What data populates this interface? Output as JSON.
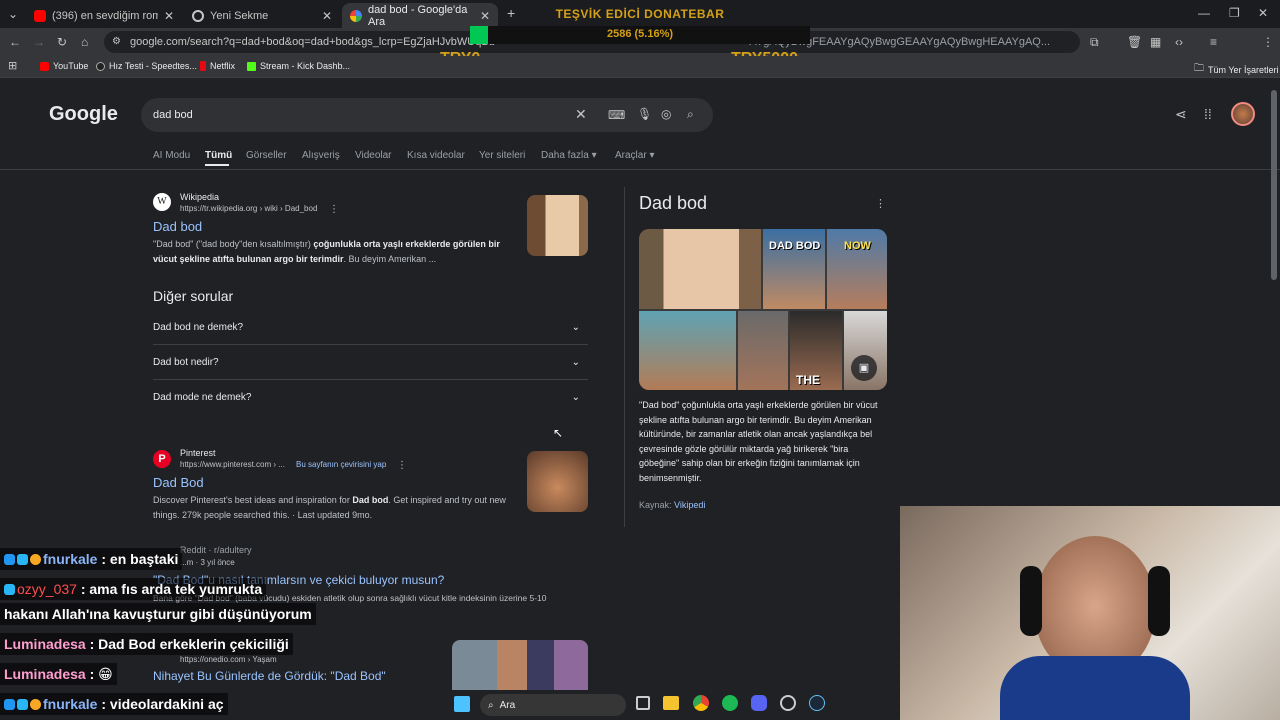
{
  "tabs": [
    {
      "title": "(396) en sevdiğim roman kavga",
      "close": "✕"
    },
    {
      "title": "Yeni Sekme",
      "close": "✕"
    },
    {
      "title": "dad bod - Google'da Ara",
      "close": "✕"
    }
  ],
  "new_tab": "+",
  "address": "google.com/search?q=dad+bod&oq=dad+bod&gs_lcrp=EgZjaHJvbWUqBu",
  "address_tail": "AYgAQyBwgFEAAYgAQyBwgGEAAYgAQyBwgHEAAYgAQ...",
  "bookmarks": [
    "YouTube",
    "Hız Testi - Speedtes...",
    "Netflix",
    "Stream - Kick Dashb..."
  ],
  "all_bookmarks": "Tüm Yer İşaretleri",
  "donation": {
    "title": "TEŞVİK EDİCİ DONATEBAR",
    "amount": "2586 (5.16%)",
    "min": "TRY0",
    "max": "TRY5000",
    "color": "#d4a017"
  },
  "google": {
    "logo": "Google",
    "query": "dad bod",
    "nav": [
      "AI Modu",
      "Tümü",
      "Görseller",
      "Alışveriş",
      "Videolar",
      "Kısa videolar",
      "Yer siteleri",
      "Daha fazla ▾",
      "Araçlar ▾"
    ],
    "result1": {
      "site": "Wikipedia",
      "url": "https://tr.wikipedia.org › wiki › Dad_bod",
      "title": "Dad bod",
      "snip_a": "\"Dad bod\" (\"dad body\"den kısaltılmıştır) ",
      "snip_b": "çoğunlukla orta yaşlı erkeklerde görülen bir vücut şekline atıfta bulunan argo bir terimdir",
      "snip_c": ". Bu deyim Amerikan ..."
    },
    "other_q_title": "Diğer sorular",
    "questions": [
      "Dad bod ne demek?",
      "Dad bot nedir?",
      "Dad mode ne demek?"
    ],
    "result2": {
      "site": "Pinterest",
      "url": "https://www.pinterest.com › ...",
      "translate": "Bu sayfanın çevirisini yap",
      "title": "Dad Bod",
      "snip_a": "Discover Pinterest's best ideas and inspiration for ",
      "snip_b": "Dad bod",
      "snip_c": ". Get inspired and try out new things. 279k people searched this. · Last updated 9mo."
    },
    "result3": {
      "site": "Reddit · r/adultery",
      "meta": "...m · 3 yıl önce",
      "title": "\"Dad Bod\"u nasıl tanımlarsın ve çekici buluyor musun?",
      "snip": "Bana göre \"Dad bod\" (baba vücudu) eskiden atletik olup sonra sağlıklı vücut kitle indeksinin üzerine 5-10"
    },
    "result4": {
      "url": "https://onedio.com › Yaşam",
      "title": "Nihayet Bu Günlerde de Gördük: \"Dad Bod\""
    },
    "kp": {
      "title": "Dad bod",
      "image_label_1": "DAD BOD",
      "image_label_2": "NOW",
      "image_label_3": "THE",
      "desc": "\"Dad bod\" çoğunlukla orta yaşlı erkeklerde görülen bir vücut şekline atıfta bulunan argo bir terimdir. Bu deyim Amerikan kültüründe, bir zamanlar atletik olan ancak yaşlandıkça bel çevresinde gözle görülür miktarda yağ birikerek \"bira göbeğine\" sahip olan bir erkeğin fiziğini tanımlamak için benimsenmiştir.",
      "src_label": "Kaynak: ",
      "src": "Vikipedi"
    }
  },
  "chat": [
    {
      "user": "fnurkale",
      "msg": ": en baştaki",
      "color": "#8ab4f8"
    },
    {
      "user": "ozyy_037",
      "msg": ": ama fıs arda tek yumrukta",
      "color": "#ff4d4d"
    },
    {
      "user": "",
      "msg": "hakanı Allah'ına kavuşturur gibi düşünüyorum",
      "color": "#ffffff"
    },
    {
      "user": "Luminadesa",
      "msg": ": Dad Bod erkeklerin çekiciliği",
      "color": "#ff9ecf"
    },
    {
      "user": "Luminadesa",
      "msg": ": 😁",
      "color": "#ff9ecf"
    },
    {
      "user": "fnurkale",
      "msg": ": videolardakini aç",
      "color": "#8ab4f8"
    }
  ],
  "taskbar": {
    "search": "Ara"
  }
}
